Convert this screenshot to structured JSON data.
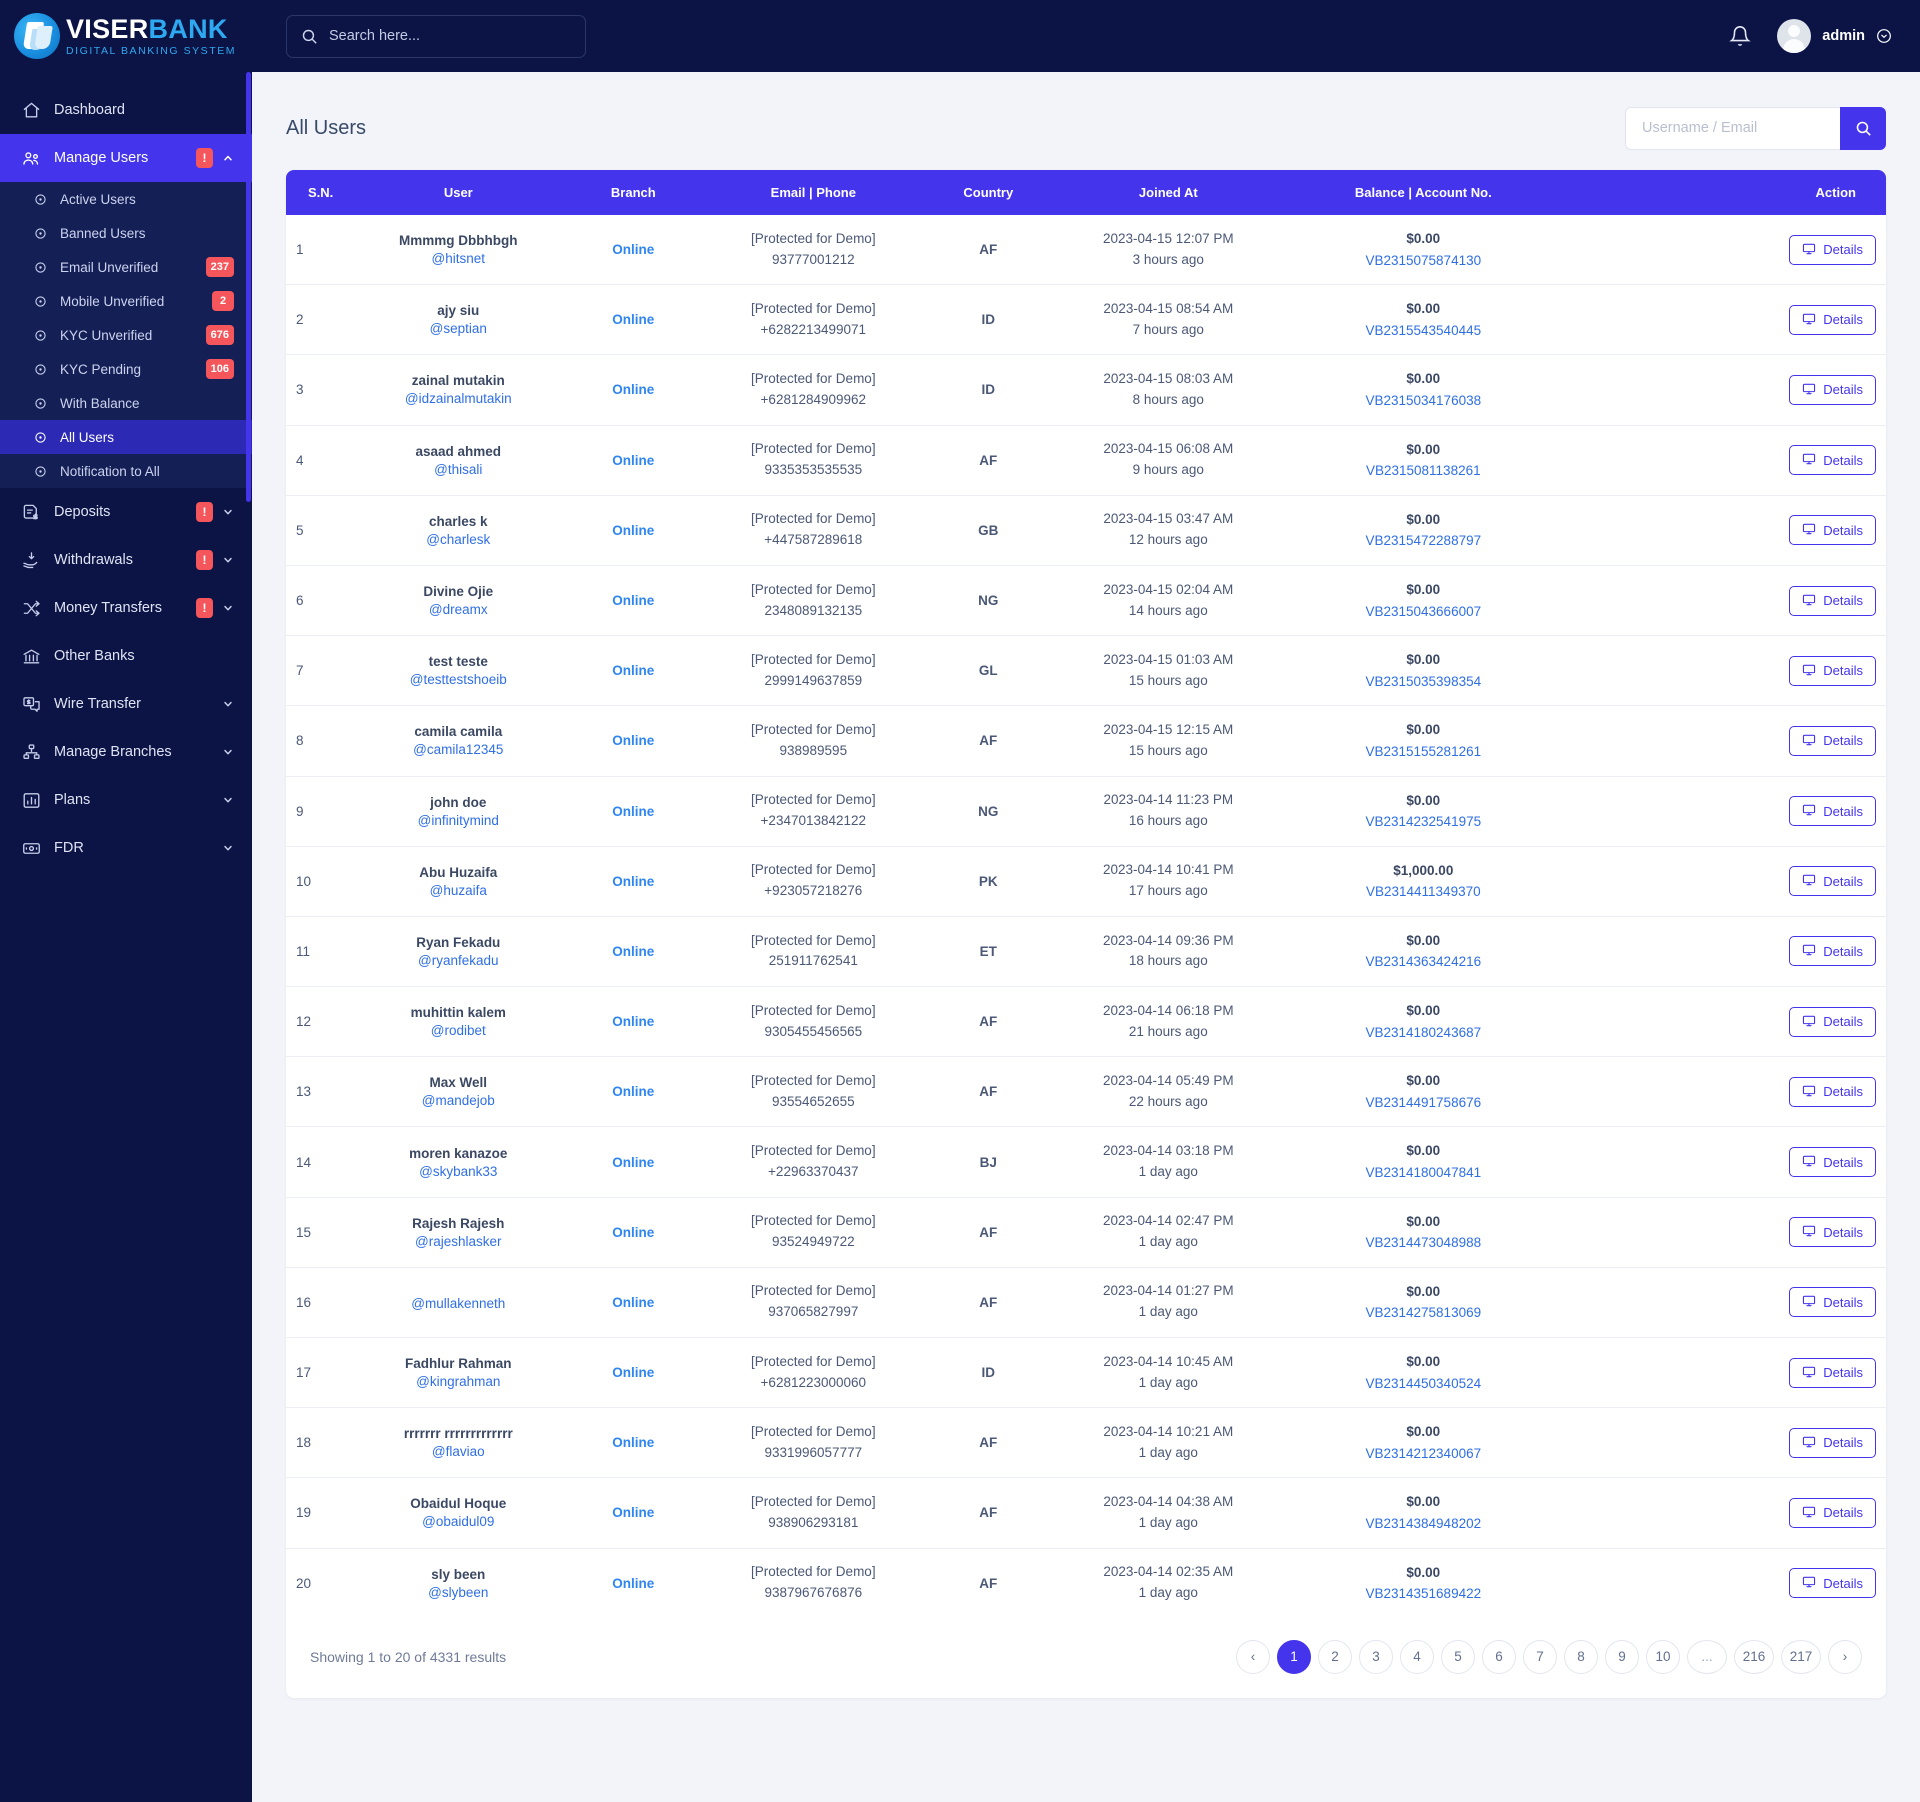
{
  "brand": {
    "name_first": "VISER",
    "name_second": "BANK",
    "tagline": "DIGITAL BANKING SYSTEM"
  },
  "topbar": {
    "search_placeholder": "Search here...",
    "username": "admin"
  },
  "sidebar": {
    "items": [
      {
        "label": "Dashboard",
        "icon": "home-icon",
        "badge": null,
        "caret": false,
        "active": false
      },
      {
        "label": "Manage Users",
        "icon": "users-icon",
        "badge": "!",
        "caret": "up",
        "active": true
      },
      {
        "label": "Deposits",
        "icon": "deposit-icon",
        "badge": "!",
        "caret": "down",
        "active": false
      },
      {
        "label": "Withdrawals",
        "icon": "withdraw-icon",
        "badge": "!",
        "caret": "down",
        "active": false
      },
      {
        "label": "Money Transfers",
        "icon": "transfer-icon",
        "badge": "!",
        "caret": "down",
        "active": false
      },
      {
        "label": "Other Banks",
        "icon": "bank-icon",
        "badge": null,
        "caret": false,
        "active": false
      },
      {
        "label": "Wire Transfer",
        "icon": "wire-icon",
        "badge": null,
        "caret": "down",
        "active": false
      },
      {
        "label": "Manage Branches",
        "icon": "branches-icon",
        "badge": null,
        "caret": "down",
        "active": false
      },
      {
        "label": "Plans",
        "icon": "chart-icon",
        "badge": null,
        "caret": "down",
        "active": false
      },
      {
        "label": "FDR",
        "icon": "money-icon",
        "badge": null,
        "caret": "down",
        "active": false
      }
    ],
    "submenu": [
      {
        "label": "Active Users",
        "badge": null,
        "active": false
      },
      {
        "label": "Banned Users",
        "badge": null,
        "active": false
      },
      {
        "label": "Email Unverified",
        "badge": "237",
        "active": false
      },
      {
        "label": "Mobile Unverified",
        "badge": "2",
        "active": false
      },
      {
        "label": "KYC Unverified",
        "badge": "676",
        "active": false
      },
      {
        "label": "KYC Pending",
        "badge": "106",
        "active": false
      },
      {
        "label": "With Balance",
        "badge": null,
        "active": false
      },
      {
        "label": "All Users",
        "badge": null,
        "active": true
      },
      {
        "label": "Notification to All",
        "badge": null,
        "active": false
      }
    ]
  },
  "page": {
    "title": "All Users",
    "search_placeholder": "Username / Email"
  },
  "table": {
    "headers": [
      "S.N.",
      "User",
      "Branch",
      "Email | Phone",
      "Country",
      "Joined At",
      "Balance | Account No.",
      "Action"
    ],
    "action_label": "Details",
    "email_masked": "[Protected for Demo]",
    "rows": [
      {
        "sn": "1",
        "name": "Mmmmg Dbbhbgh",
        "username": "@hitsnet",
        "branch": "Online",
        "phone": "93777001212",
        "country": "AF",
        "joined": "2023-04-15 12:07 PM",
        "ago": "3 hours ago",
        "balance": "$0.00",
        "account": "VB2315075874130"
      },
      {
        "sn": "2",
        "name": "ajy siu",
        "username": "@septian",
        "branch": "Online",
        "phone": "+6282213499071",
        "country": "ID",
        "joined": "2023-04-15 08:54 AM",
        "ago": "7 hours ago",
        "balance": "$0.00",
        "account": "VB2315543540445"
      },
      {
        "sn": "3",
        "name": "zainal mutakin",
        "username": "@idzainalmutakin",
        "branch": "Online",
        "phone": "+6281284909962",
        "country": "ID",
        "joined": "2023-04-15 08:03 AM",
        "ago": "8 hours ago",
        "balance": "$0.00",
        "account": "VB2315034176038"
      },
      {
        "sn": "4",
        "name": "asaad ahmed",
        "username": "@thisali",
        "branch": "Online",
        "phone": "9335353535535",
        "country": "AF",
        "joined": "2023-04-15 06:08 AM",
        "ago": "9 hours ago",
        "balance": "$0.00",
        "account": "VB2315081138261"
      },
      {
        "sn": "5",
        "name": "charles k",
        "username": "@charlesk",
        "branch": "Online",
        "phone": "+447587289618",
        "country": "GB",
        "joined": "2023-04-15 03:47 AM",
        "ago": "12 hours ago",
        "balance": "$0.00",
        "account": "VB2315472288797"
      },
      {
        "sn": "6",
        "name": "Divine Ojie",
        "username": "@dreamx",
        "branch": "Online",
        "phone": "2348089132135",
        "country": "NG",
        "joined": "2023-04-15 02:04 AM",
        "ago": "14 hours ago",
        "balance": "$0.00",
        "account": "VB2315043666007"
      },
      {
        "sn": "7",
        "name": "test teste",
        "username": "@testtestshoeib",
        "branch": "Online",
        "phone": "2999149637859",
        "country": "GL",
        "joined": "2023-04-15 01:03 AM",
        "ago": "15 hours ago",
        "balance": "$0.00",
        "account": "VB2315035398354"
      },
      {
        "sn": "8",
        "name": "camila camila",
        "username": "@camila12345",
        "branch": "Online",
        "phone": "938989595",
        "country": "AF",
        "joined": "2023-04-15 12:15 AM",
        "ago": "15 hours ago",
        "balance": "$0.00",
        "account": "VB2315155281261"
      },
      {
        "sn": "9",
        "name": "john doe",
        "username": "@infinitymind",
        "branch": "Online",
        "phone": "+2347013842122",
        "country": "NG",
        "joined": "2023-04-14 11:23 PM",
        "ago": "16 hours ago",
        "balance": "$0.00",
        "account": "VB2314232541975"
      },
      {
        "sn": "10",
        "name": "Abu Huzaifa",
        "username": "@huzaifa",
        "branch": "Online",
        "phone": "+923057218276",
        "country": "PK",
        "joined": "2023-04-14 10:41 PM",
        "ago": "17 hours ago",
        "balance": "$1,000.00",
        "account": "VB2314411349370"
      },
      {
        "sn": "11",
        "name": "Ryan Fekadu",
        "username": "@ryanfekadu",
        "branch": "Online",
        "phone": "251911762541",
        "country": "ET",
        "joined": "2023-04-14 09:36 PM",
        "ago": "18 hours ago",
        "balance": "$0.00",
        "account": "VB2314363424216"
      },
      {
        "sn": "12",
        "name": "muhittin kalem",
        "username": "@rodibet",
        "branch": "Online",
        "phone": "9305455456565",
        "country": "AF",
        "joined": "2023-04-14 06:18 PM",
        "ago": "21 hours ago",
        "balance": "$0.00",
        "account": "VB2314180243687"
      },
      {
        "sn": "13",
        "name": "Max Well",
        "username": "@mandejob",
        "branch": "Online",
        "phone": "93554652655",
        "country": "AF",
        "joined": "2023-04-14 05:49 PM",
        "ago": "22 hours ago",
        "balance": "$0.00",
        "account": "VB2314491758676"
      },
      {
        "sn": "14",
        "name": "moren kanazoe",
        "username": "@skybank33",
        "branch": "Online",
        "phone": "+22963370437",
        "country": "BJ",
        "joined": "2023-04-14 03:18 PM",
        "ago": "1 day ago",
        "balance": "$0.00",
        "account": "VB2314180047841"
      },
      {
        "sn": "15",
        "name": "Rajesh Rajesh",
        "username": "@rajeshlasker",
        "branch": "Online",
        "phone": "93524949722",
        "country": "AF",
        "joined": "2023-04-14 02:47 PM",
        "ago": "1 day ago",
        "balance": "$0.00",
        "account": "VB2314473048988"
      },
      {
        "sn": "16",
        "name": "",
        "username": "@mullakenneth",
        "branch": "Online",
        "phone": "937065827997",
        "country": "AF",
        "joined": "2023-04-14 01:27 PM",
        "ago": "1 day ago",
        "balance": "$0.00",
        "account": "VB2314275813069"
      },
      {
        "sn": "17",
        "name": "Fadhlur Rahman",
        "username": "@kingrahman",
        "branch": "Online",
        "phone": "+6281223000060",
        "country": "ID",
        "joined": "2023-04-14 10:45 AM",
        "ago": "1 day ago",
        "balance": "$0.00",
        "account": "VB2314450340524"
      },
      {
        "sn": "18",
        "name": "rrrrrrr rrrrrrrrrrrrr",
        "username": "@flaviao",
        "branch": "Online",
        "phone": "9331996057777",
        "country": "AF",
        "joined": "2023-04-14 10:21 AM",
        "ago": "1 day ago",
        "balance": "$0.00",
        "account": "VB2314212340067"
      },
      {
        "sn": "19",
        "name": "Obaidul Hoque",
        "username": "@obaidul09",
        "branch": "Online",
        "phone": "938906293181",
        "country": "AF",
        "joined": "2023-04-14 04:38 AM",
        "ago": "1 day ago",
        "balance": "$0.00",
        "account": "VB2314384948202"
      },
      {
        "sn": "20",
        "name": "sly been",
        "username": "@slybeen",
        "branch": "Online",
        "phone": "9387967676876",
        "country": "AF",
        "joined": "2023-04-14 02:35 AM",
        "ago": "1 day ago",
        "balance": "$0.00",
        "account": "VB2314351689422"
      }
    ]
  },
  "footer": {
    "showing": "Showing 1 to 20 of 4331 results",
    "pages": [
      {
        "label": "‹",
        "active": false,
        "kind": "prev"
      },
      {
        "label": "1",
        "active": true,
        "kind": "num"
      },
      {
        "label": "2",
        "active": false,
        "kind": "num"
      },
      {
        "label": "3",
        "active": false,
        "kind": "num"
      },
      {
        "label": "4",
        "active": false,
        "kind": "num"
      },
      {
        "label": "5",
        "active": false,
        "kind": "num"
      },
      {
        "label": "6",
        "active": false,
        "kind": "num"
      },
      {
        "label": "7",
        "active": false,
        "kind": "num"
      },
      {
        "label": "8",
        "active": false,
        "kind": "num"
      },
      {
        "label": "9",
        "active": false,
        "kind": "num"
      },
      {
        "label": "10",
        "active": false,
        "kind": "num"
      },
      {
        "label": "...",
        "active": false,
        "kind": "dots"
      },
      {
        "label": "216",
        "active": false,
        "kind": "num"
      },
      {
        "label": "217",
        "active": false,
        "kind": "num"
      },
      {
        "label": "›",
        "active": false,
        "kind": "next"
      }
    ]
  },
  "colors": {
    "accent": "#4434ec",
    "sidebar": "#0b1445",
    "danger": "#f5565c",
    "link": "#2f6fe4",
    "branch": "#2f86f0"
  }
}
